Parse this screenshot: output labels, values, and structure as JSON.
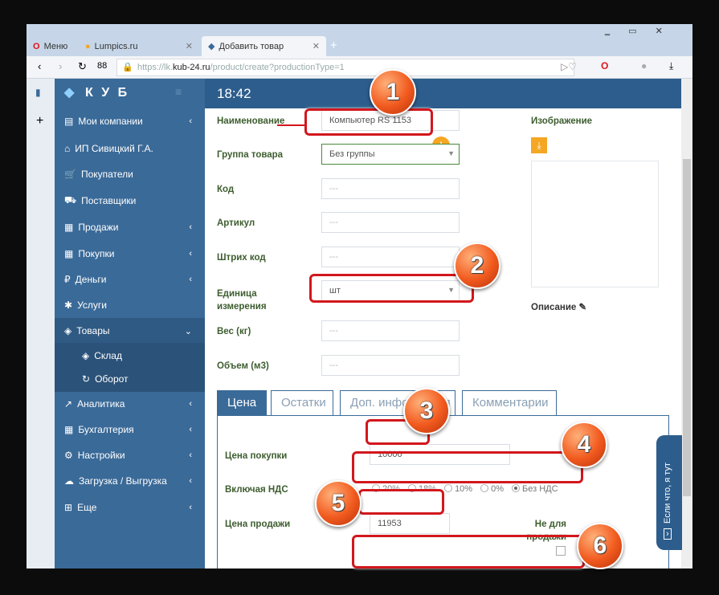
{
  "browser": {
    "menu": "Меню",
    "tabs": [
      {
        "title": "Lumpics.ru"
      },
      {
        "title": "Добавить товар"
      }
    ],
    "url_prefix": "https://lk.",
    "url_domain": "kub-24.ru",
    "url_path": "/product/create?productionType=1"
  },
  "sidebar": {
    "logo": "К У Б",
    "items": [
      {
        "label": "Мои компании",
        "chev": "‹"
      },
      {
        "label": "ИП Сивицкий Г.А."
      },
      {
        "label": "Покупатели"
      },
      {
        "label": "Поставщики"
      },
      {
        "label": "Продажи",
        "chev": "‹"
      },
      {
        "label": "Покупки",
        "chev": "‹"
      },
      {
        "label": "Деньги",
        "chev": "‹"
      },
      {
        "label": "Услуги"
      },
      {
        "label": "Товары",
        "chev": "⌄"
      },
      {
        "label": "Склад"
      },
      {
        "label": "Оборот"
      },
      {
        "label": "Аналитика",
        "chev": "‹"
      },
      {
        "label": "Бухгалтерия",
        "chev": "‹"
      },
      {
        "label": "Настройки",
        "chev": "‹"
      },
      {
        "label": "Загрузка / Выгрузка",
        "chev": "‹"
      },
      {
        "label": "Еще",
        "chev": "‹"
      }
    ]
  },
  "header": {
    "time": "18:42"
  },
  "form": {
    "name_label": "Наименование",
    "name_value": "Компьютер RS 1153",
    "group_label": "Группа товара",
    "group_value": "Без группы",
    "code_label": "Код",
    "article_label": "Артикул",
    "barcode_label": "Штрих код",
    "unit_label": "Единица измерения",
    "unit_value": "шт",
    "weight_label": "Вес (кг)",
    "volume_label": "Объем (м3)",
    "placeholder": "---",
    "image_label": "Изображение",
    "description_label": "Описание"
  },
  "tabs": [
    "Цена",
    "Остатки",
    "Доп. информация",
    "Комментарии"
  ],
  "price": {
    "buy_label": "Цена покупки",
    "buy_value": "10000",
    "vat_label": "Включая НДС",
    "vat_options": [
      "20%",
      "18%",
      "10%",
      "0%",
      "Без НДС"
    ],
    "buy_vat_selected": "Без НДС",
    "sell_label": "Цена продажи",
    "sell_value": "11953",
    "not_for_sale_label": "Не для продажи",
    "not_for_sale_checked": false,
    "sell_vat_selected": "20%"
  },
  "help_widget": "Если что, я тут",
  "badges": [
    "1",
    "2",
    "3",
    "4",
    "5",
    "6"
  ],
  "colors": {
    "sidebar": "#3a6a98",
    "header": "#2d5d8c",
    "accent": "#f5a623",
    "highlight": "#d2171c"
  }
}
